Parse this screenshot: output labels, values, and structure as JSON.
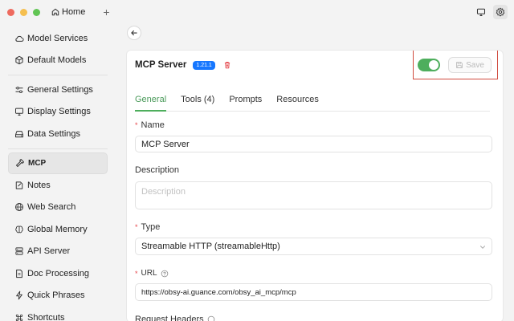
{
  "window": {
    "tab_label": "Home",
    "new_tab": "+"
  },
  "sidebar": {
    "groups": [
      [
        {
          "id": "model-services",
          "label": "Model Services",
          "icon": "cloud-icon"
        },
        {
          "id": "default-models",
          "label": "Default Models",
          "icon": "cube-icon"
        }
      ],
      [
        {
          "id": "general-settings",
          "label": "General Settings",
          "icon": "sliders-icon"
        },
        {
          "id": "display-settings",
          "label": "Display Settings",
          "icon": "monitor-icon"
        },
        {
          "id": "data-settings",
          "label": "Data Settings",
          "icon": "drive-icon"
        }
      ],
      [
        {
          "id": "mcp",
          "label": "MCP",
          "icon": "hammer-icon",
          "active": true
        },
        {
          "id": "notes",
          "label": "Notes",
          "icon": "note-icon"
        },
        {
          "id": "web-search",
          "label": "Web Search",
          "icon": "globe-icon"
        },
        {
          "id": "global-memory",
          "label": "Global Memory",
          "icon": "brain-icon"
        },
        {
          "id": "api-server",
          "label": "API Server",
          "icon": "server-icon"
        },
        {
          "id": "doc-processing",
          "label": "Doc Processing",
          "icon": "document-icon"
        },
        {
          "id": "quick-phrases",
          "label": "Quick Phrases",
          "icon": "zap-icon"
        },
        {
          "id": "shortcuts",
          "label": "Shortcuts",
          "icon": "command-icon"
        }
      ]
    ]
  },
  "server": {
    "title": "MCP Server",
    "version": "1.21.1",
    "enabled": true,
    "save_label": "Save"
  },
  "tabs": [
    {
      "id": "general",
      "label": "General",
      "active": true
    },
    {
      "id": "tools",
      "label": "Tools (4)"
    },
    {
      "id": "prompts",
      "label": "Prompts"
    },
    {
      "id": "resources",
      "label": "Resources"
    }
  ],
  "form": {
    "name_label": "Name",
    "name_value": "MCP Server",
    "description_label": "Description",
    "description_placeholder": "Description",
    "type_label": "Type",
    "type_value": "Streamable HTTP (streamableHttp)",
    "url_label": "URL",
    "url_value": "https://obsy-ai.guance.com/obsy_ai_mcp/mcp",
    "headers_label": "Request Headers"
  },
  "colors": {
    "accent": "#4eae5d",
    "version_badge": "#1677ff",
    "highlight": "#d04a3d",
    "required": "#e5484d"
  }
}
